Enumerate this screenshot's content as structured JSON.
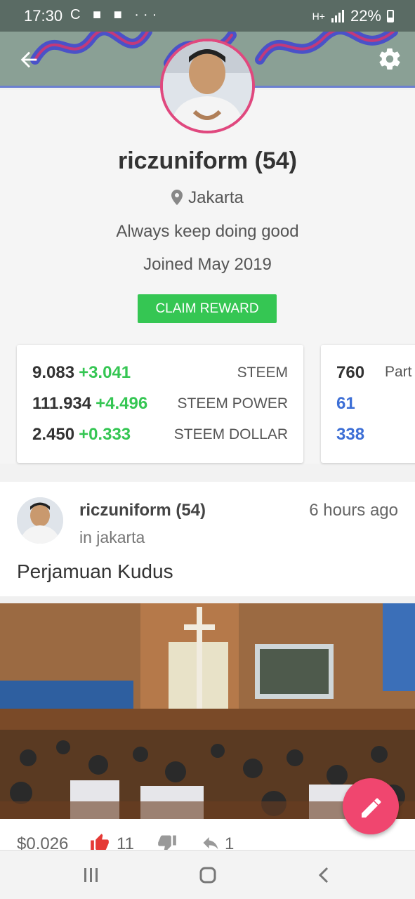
{
  "status_bar": {
    "time": "17:30",
    "notification_icons": "C ■ ■ ···",
    "network": "H+",
    "battery": "22%"
  },
  "header": {
    "back_icon": "arrow-left-icon",
    "settings_icon": "gear-icon",
    "cover_color": "#8aa095",
    "accent": "#e0487e"
  },
  "profile": {
    "name": "riczuniform (54)",
    "location": "Jakarta",
    "about": "Always keep doing good",
    "joined": "Joined May 2019",
    "claim_label": "CLAIM REWARD"
  },
  "wallet": [
    {
      "value": "9.083",
      "delta": "+3.041",
      "label": "STEEM"
    },
    {
      "value": "111.934",
      "delta": "+4.496",
      "label": "STEEM POWER"
    },
    {
      "value": "2.450",
      "delta": "+0.333",
      "label": "STEEM DOLLAR"
    }
  ],
  "stats": {
    "first_value": "760",
    "first_label": "Part",
    "second_value": "61",
    "third_value": "338"
  },
  "post": {
    "author": "riczuniform (54)",
    "time": "6 hours ago",
    "community": "in jakarta",
    "title": "Perjamuan Kudus",
    "payout": "$0.026",
    "upvotes": "11",
    "replies": "1"
  },
  "fab": {
    "icon": "pencil-icon",
    "color": "#f0466f"
  },
  "nav": {
    "recent_icon": "recent-apps-icon",
    "home_icon": "home-icon",
    "back_icon": "nav-back-icon"
  }
}
